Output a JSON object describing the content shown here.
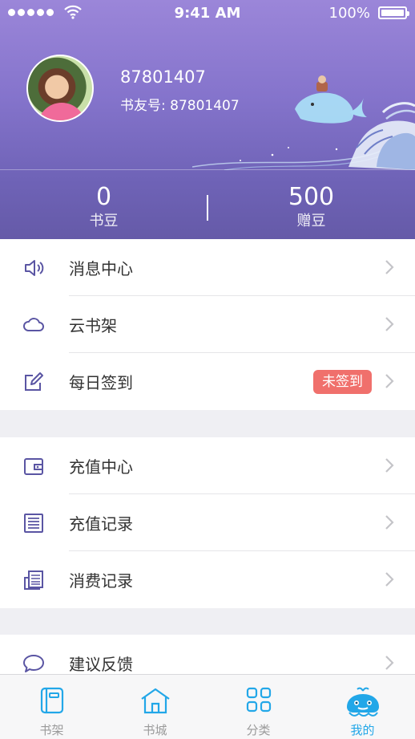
{
  "status_bar": {
    "time": "9:41 AM",
    "battery": "100%"
  },
  "profile": {
    "name": "87801407",
    "friend_id": "书友号: 87801407"
  },
  "stats": [
    {
      "value": "0",
      "label": "书豆"
    },
    {
      "value": "500",
      "label": "赠豆"
    }
  ],
  "menu": {
    "group1": [
      {
        "label": "消息中心",
        "icon": "speaker-icon"
      },
      {
        "label": "云书架",
        "icon": "cloud-icon"
      },
      {
        "label": "每日签到",
        "icon": "edit-icon",
        "badge": "未签到"
      }
    ],
    "group2": [
      {
        "label": "充值中心",
        "icon": "wallet-icon"
      },
      {
        "label": "充值记录",
        "icon": "list-icon"
      },
      {
        "label": "消费记录",
        "icon": "receipt-icon"
      }
    ],
    "group3": [
      {
        "label": "建议反馈",
        "icon": "chat-bubble-icon"
      }
    ]
  },
  "tabs": [
    {
      "label": "书架",
      "icon": "book-icon"
    },
    {
      "label": "书城",
      "icon": "house-icon"
    },
    {
      "label": "分类",
      "icon": "grid-icon"
    },
    {
      "label": "我的",
      "icon": "whale-icon",
      "active": true
    }
  ],
  "colors": {
    "accent": "#22a7e8",
    "header": "#8574cc",
    "badge": "#f0706c",
    "menu_icon": "#5a55a3"
  }
}
